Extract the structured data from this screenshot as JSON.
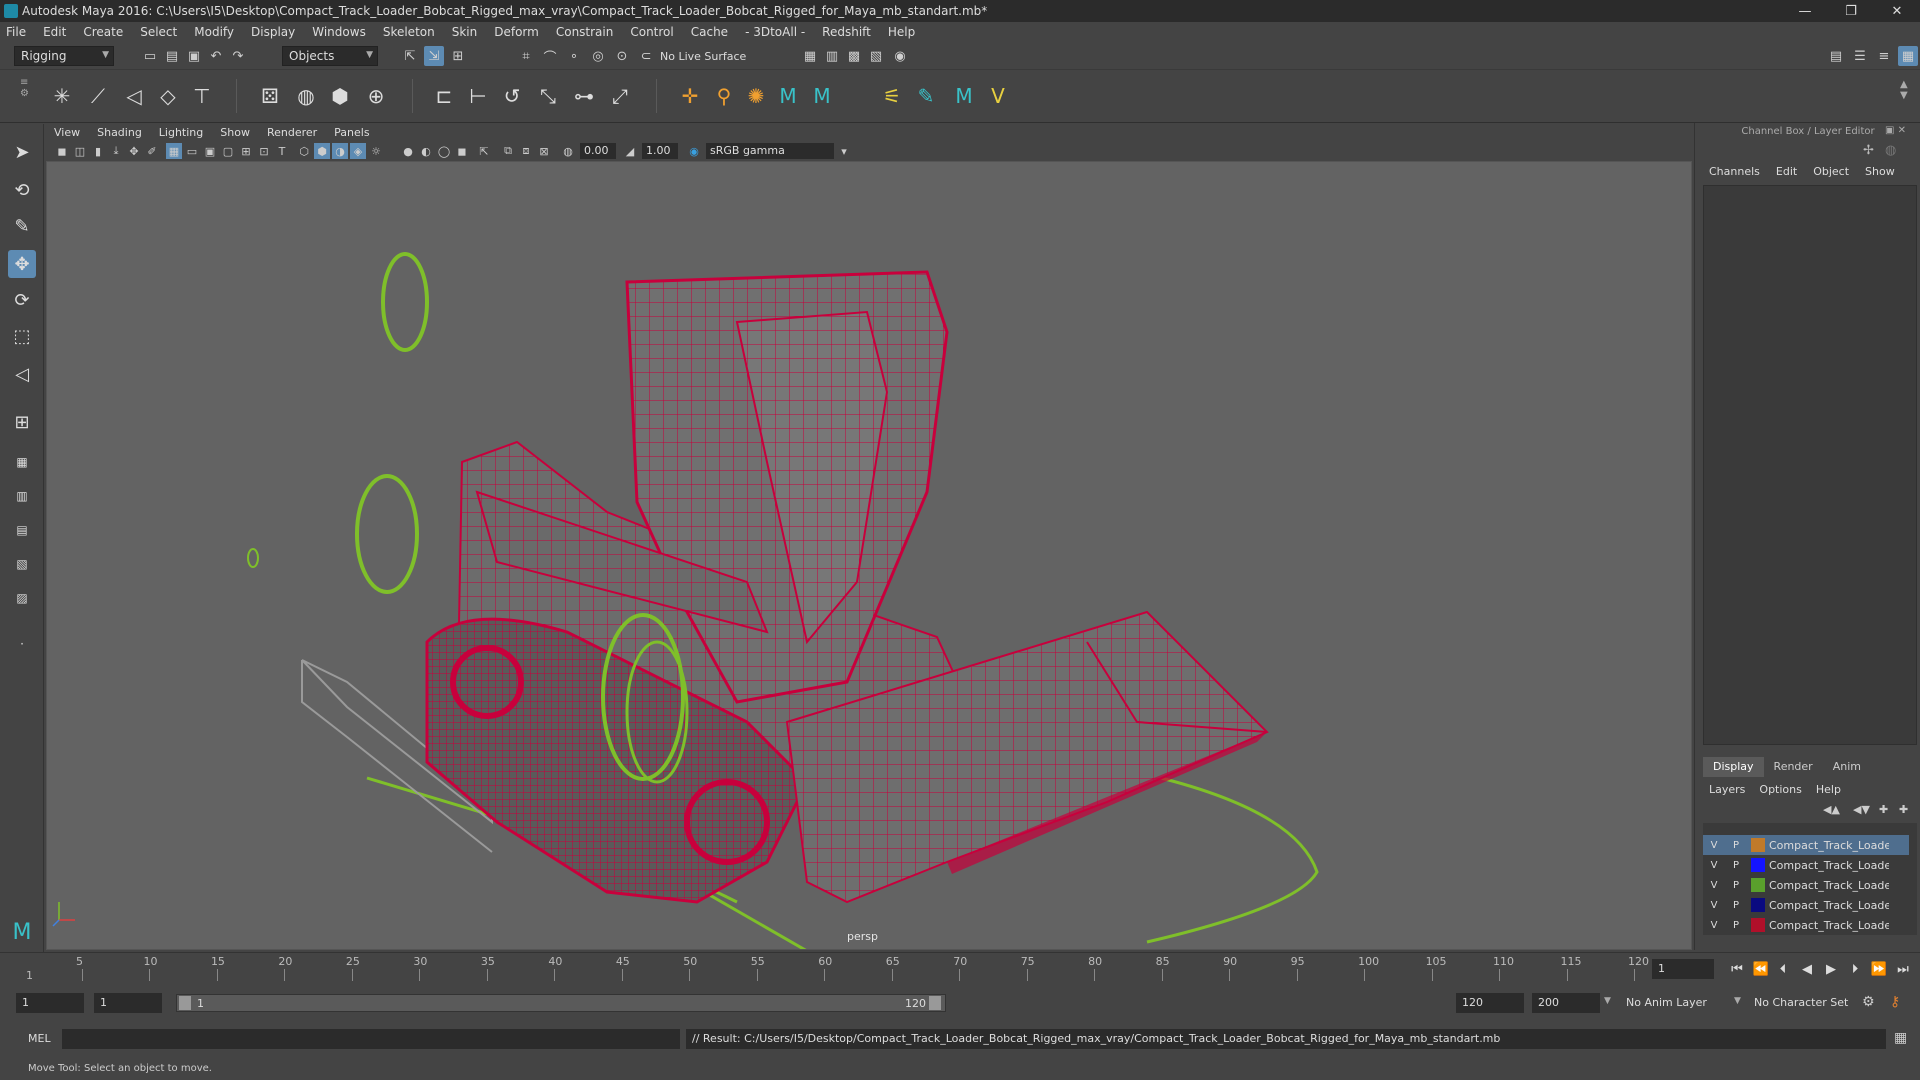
{
  "window": {
    "title": "Autodesk Maya 2016: C:\\Users\\I5\\Desktop\\Compact_Track_Loader_Bobcat_Rigged_max_vray\\Compact_Track_Loader_Bobcat_Rigged_for_Maya_mb_standart.mb*",
    "minimize": "—",
    "maximize": "❐",
    "close": "✕"
  },
  "menubar": [
    "File",
    "Edit",
    "Create",
    "Select",
    "Modify",
    "Display",
    "Windows",
    "Skeleton",
    "Skin",
    "Deform",
    "Constrain",
    "Control",
    "Cache",
    "- 3DtoAll -",
    "Redshift",
    "Help"
  ],
  "statusline": {
    "menuset": "Rigging",
    "selection_mode": "Objects",
    "live_surface": "No Live Surface"
  },
  "panel_menu": [
    "View",
    "Shading",
    "Lighting",
    "Show",
    "Renderer",
    "Panels"
  ],
  "panel_toolbar": {
    "exposure": "0.00",
    "gamma": "1.00",
    "color_space": "sRGB gamma"
  },
  "viewport": {
    "camera": "persp"
  },
  "channel_box": {
    "title": "Channel Box / Layer Editor",
    "menu": [
      "Channels",
      "Edit",
      "Object",
      "Show"
    ],
    "tabs": [
      "Display",
      "Render",
      "Anim"
    ],
    "layer_menu": [
      "Layers",
      "Options",
      "Help"
    ],
    "layers": [
      {
        "v": "V",
        "p": "P",
        "color": "#c07a2a",
        "name": "Compact_Track_Loader_Bobcat"
      },
      {
        "v": "V",
        "p": "P",
        "color": "#1414ff",
        "name": "Compact_Track_Loader_Bobcat"
      },
      {
        "v": "V",
        "p": "P",
        "color": "#5aa02c",
        "name": "Compact_Track_Loader_Bobcat"
      },
      {
        "v": "V",
        "p": "P",
        "color": "#0a0a80",
        "name": "Compact_Track_Loader_Bobcat"
      },
      {
        "v": "V",
        "p": "P",
        "color": "#b0102a",
        "name": "Compact_Track_Loader_Bobcat"
      }
    ]
  },
  "timeline": {
    "ticks": [
      "5",
      "10",
      "15",
      "20",
      "25",
      "30",
      "35",
      "40",
      "45",
      "50",
      "55",
      "60",
      "65",
      "70",
      "75",
      "80",
      "85",
      "90",
      "95",
      "100",
      "105",
      "110",
      "115",
      "120"
    ],
    "first_tick": "1",
    "current_frame": "1"
  },
  "range": {
    "start": "1",
    "playback_start": "1",
    "slider_start": "1",
    "slider_end": "120",
    "playback_end": "120",
    "end": "200",
    "anim_layer": "No Anim Layer",
    "character_set": "No Character Set"
  },
  "command": {
    "language": "MEL",
    "result": "// Result: C:/Users/I5/Desktop/Compact_Track_Loader_Bobcat_Rigged_max_vray/Compact_Track_Loader_Bobcat_Rigged_for_Maya_mb_standart.mb"
  },
  "help_line": "Move Tool: Select an object to move.",
  "colors": {
    "wire": "#c8003c",
    "rig": "#7fbf2a",
    "accent": "#5d8bb3"
  }
}
